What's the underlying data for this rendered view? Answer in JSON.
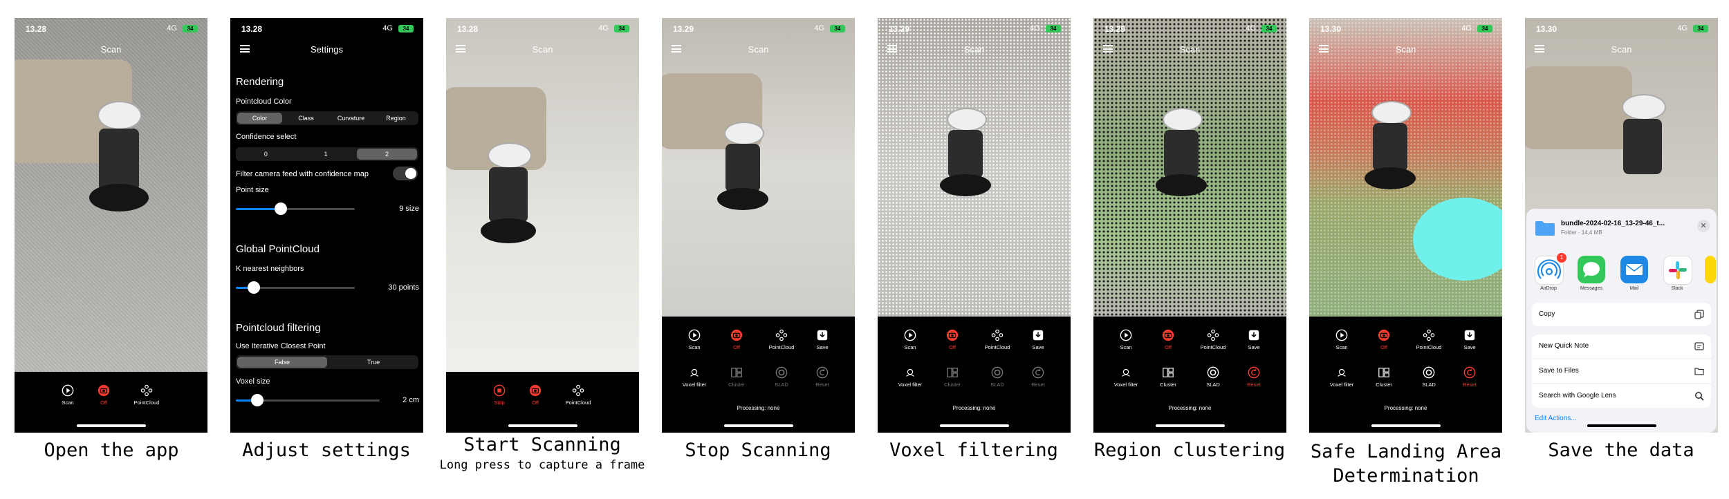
{
  "captions": [
    {
      "title": "Open the app",
      "sub": ""
    },
    {
      "title": "Adjust settings",
      "sub": ""
    },
    {
      "title": "Start Scanning",
      "sub": "Long press to capture a frame"
    },
    {
      "title": "Stop Scanning",
      "sub": ""
    },
    {
      "title": "Voxel filtering",
      "sub": ""
    },
    {
      "title": "Region clustering",
      "sub": ""
    },
    {
      "title": "Safe Landing Area Determination",
      "sub": ""
    },
    {
      "title": "Save the data",
      "sub": ""
    }
  ],
  "status": {
    "time1": "13.28",
    "time2": "13.28",
    "time3": "13.28",
    "time4": "13.29",
    "time5": "13.29",
    "time6": "13.29",
    "time7": "13.30",
    "time8": "13.30",
    "network": "4G"
  },
  "nav": {
    "scan": "Scan",
    "settings": "Settings"
  },
  "tools": {
    "scan": "Scan",
    "off": "Off",
    "pointcloud": "PointCloud",
    "stop": "Stop",
    "save": "Save",
    "voxel": "Voxel filter",
    "cluster": "Cluster",
    "slad": "SLAD",
    "reset": "Reset",
    "processing": "Processing: none"
  },
  "settings": {
    "rendering": "Rendering",
    "pc_color": "Pointcloud Color",
    "color_opts": [
      "Color",
      "Class",
      "Curvature",
      "Region"
    ],
    "confidence": "Confidence select",
    "conf_opts": [
      "0",
      "1",
      "2"
    ],
    "filter_label": "Filter camera feed with confidence map",
    "point_size": "Point size",
    "point_size_val": "9 size",
    "point_size_level": 0.38,
    "global": "Global PointCloud",
    "knn": "K nearest neighbors",
    "knn_val": "30 points",
    "knn_level": 0.15,
    "filtering": "Pointcloud filtering",
    "icp": "Use Iterative Closest Point",
    "icp_opts": [
      "False",
      "True"
    ],
    "voxel_size": "Voxel size",
    "voxel_val": "2 cm",
    "voxel_level": 0.15
  },
  "share": {
    "folder": "bundle-2024-02-16_13-29-46_t...",
    "folder_meta": "Folder · 14,4 MB",
    "apps": [
      "AirDrop",
      "Messages",
      "Mail",
      "Slack"
    ],
    "airdrop_badge": "1",
    "actions": [
      "Copy",
      "New Quick Note",
      "Save to Files",
      "Search with Google Lens"
    ],
    "edit": "Edit Actions..."
  },
  "colors": {
    "accent": "#0a84ff",
    "red": "#ff3b30",
    "battery": "#34c759"
  }
}
